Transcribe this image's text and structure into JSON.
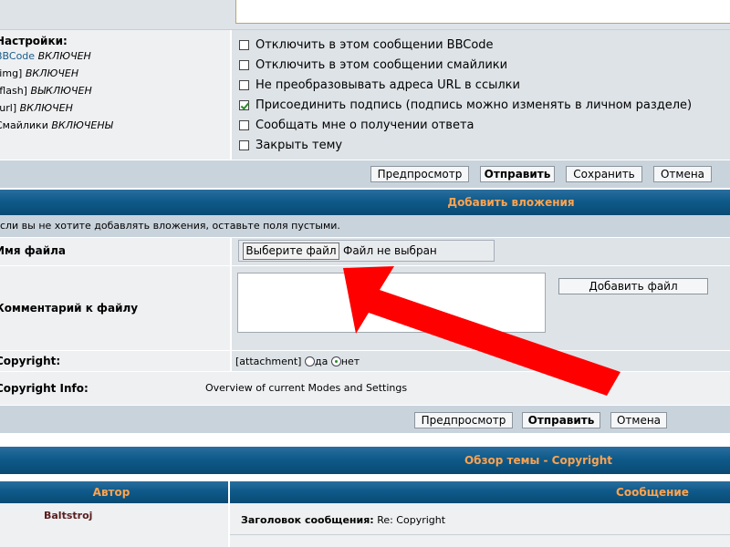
{
  "options": {
    "settings_title": "Настройки:",
    "settings_lines": [
      {
        "key": "BBCode",
        "value": "ВКЛЮЧЕН"
      },
      {
        "key": "[img]",
        "value": "ВКЛЮЧЕН"
      },
      {
        "key": "[flash]",
        "value": "ВЫКЛЮЧЕН"
      },
      {
        "key": "[url]",
        "value": "ВКЛЮЧЕН"
      },
      {
        "key": "Смайлики",
        "value": "ВКЛЮЧЕНЫ"
      }
    ],
    "checkboxes": [
      {
        "label": "Отключить в этом сообщении BBCode",
        "checked": false
      },
      {
        "label": "Отключить в этом сообщении смайлики",
        "checked": false
      },
      {
        "label": "Не преобразовывать адреса URL в ссылки",
        "checked": false
      },
      {
        "label": "Присоединить подпись (подпись можно изменять в личном разделе)",
        "checked": true
      },
      {
        "label": "Сообщать мне о получении ответа",
        "checked": false
      },
      {
        "label": "Закрыть тему",
        "checked": false
      }
    ]
  },
  "submit_bar": {
    "preview": "Предпросмотр",
    "submit": "Отправить",
    "save": "Сохранить",
    "cancel": "Отмена"
  },
  "attachments": {
    "header": "Добавить вложения",
    "hint": "Если вы не хотите добавлять вложения, оставьте поля пустыми.",
    "filename_label": "Имя файла",
    "choose_file": "Выберите файл",
    "no_file": "Файл не выбран",
    "comment_label": "Комментарий к файлу",
    "add_file": "Добавить файл",
    "copyright_label": "Copyright:",
    "attachment_tag": "[attachment]",
    "radio_yes": "да",
    "radio_no": "нет",
    "radio_selected": "нет",
    "copyright_info_label": "Copyright Info:",
    "copyright_info_value": "Overview of current Modes and Settings"
  },
  "submit_bar2": {
    "preview": "Предпросмотр",
    "submit": "Отправить",
    "cancel": "Отмена"
  },
  "topic_review": {
    "header": "Обзор темы - Copyright",
    "col_author": "Автор",
    "col_message": "Сообщение",
    "author": "Baltstroj",
    "subject_label": "Заголовок сообщения:",
    "subject": "Re: Copyright"
  },
  "annotation": {
    "type": "arrow",
    "color": "#ff0000"
  }
}
